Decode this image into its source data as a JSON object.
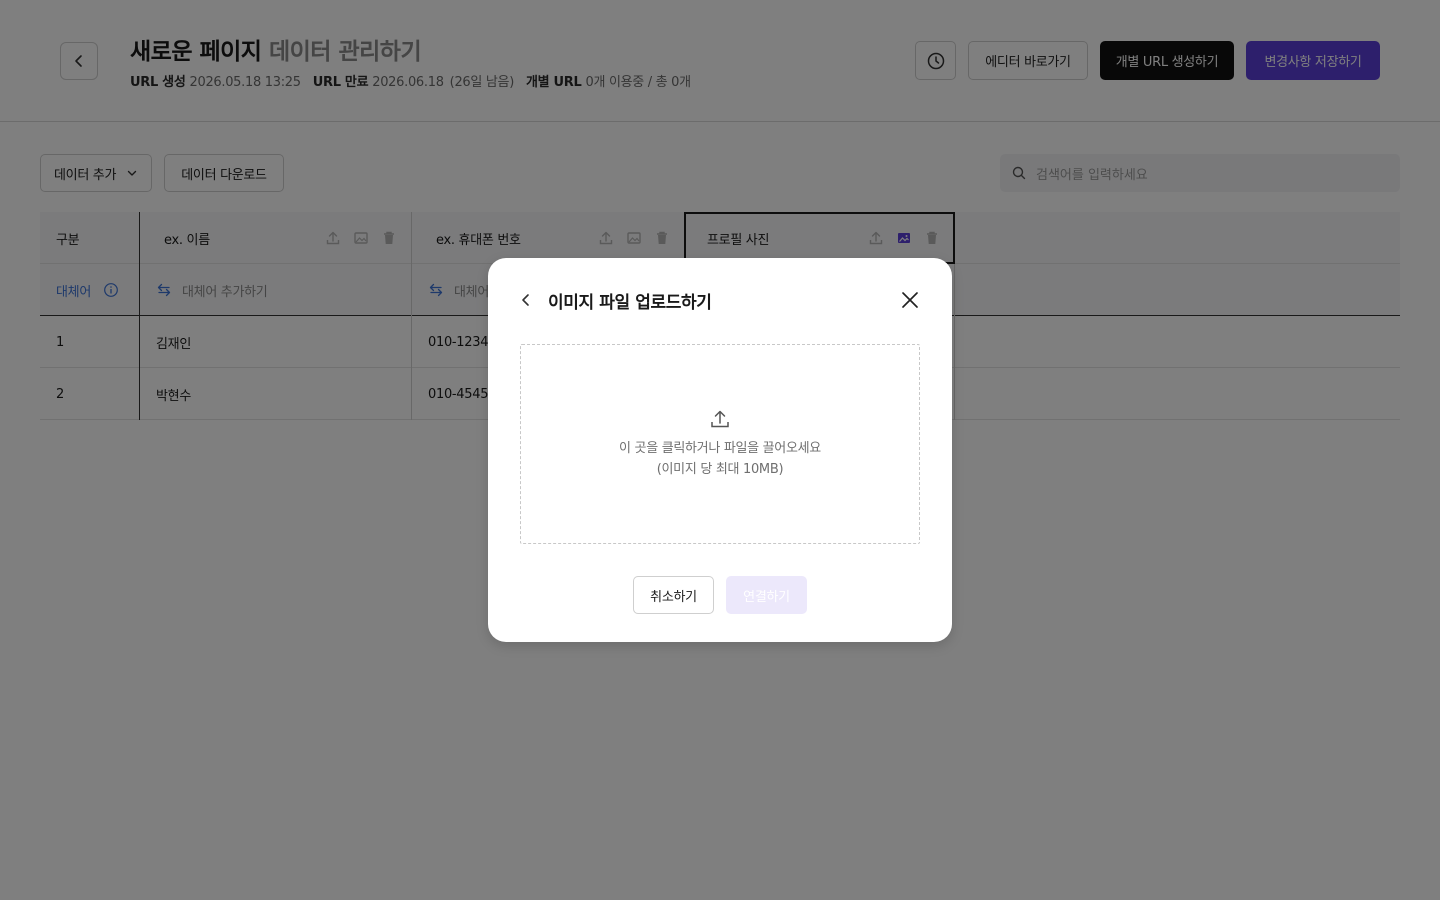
{
  "header": {
    "title_main": "새로운 페이지",
    "title_sub": "데이터 관리하기",
    "meta": {
      "url_created_label": "URL 생성",
      "url_created_value": "2026.05.18 13:25",
      "url_expire_label": "URL 만료",
      "url_expire_value": "2026.06.18",
      "url_expire_remaining": "(26일 남음)",
      "individual_url_label": "개별 URL",
      "individual_url_value": "0개 이용중 / 총 0개"
    },
    "editor_button": "에디터 바로가기",
    "create_url_button": "개별 URL 생성하기",
    "save_button": "변경사항 저장하기"
  },
  "toolbar": {
    "add_data": "데이터 추가",
    "download_data": "데이터 다운로드",
    "search_placeholder": "검색어를 입력하세요"
  },
  "table": {
    "columns": [
      "구분",
      "ex. 이름",
      "ex. 휴대폰 번호",
      "프로필 사진"
    ],
    "alt_row_label": "대체어",
    "alt_add_label": "대체어 추가하기",
    "alt_add_truncated": "대체어",
    "rows": [
      {
        "index": "1",
        "name": "김재인",
        "phone": "010-1234"
      },
      {
        "index": "2",
        "name": "박현수",
        "phone": "010-4545"
      }
    ]
  },
  "modal": {
    "title": "이미지 파일 업로드하기",
    "dropzone_line1": "이 곳을 클릭하거나 파일을 끌어오세요",
    "dropzone_line2": "(이미지 당 최대 10MB)",
    "cancel_button": "취소하기",
    "connect_button": "연결하기"
  },
  "colors": {
    "primary": "#5b3fd9",
    "link_blue": "#3c73d6",
    "connect_disabled_bg": "#ece8fb"
  },
  "icons": [
    "chevron-left-icon",
    "clock-history-icon",
    "chevron-down-icon",
    "search-icon",
    "upload-icon",
    "image-icon",
    "trash-icon",
    "info-icon",
    "swap-icon",
    "close-icon"
  ]
}
